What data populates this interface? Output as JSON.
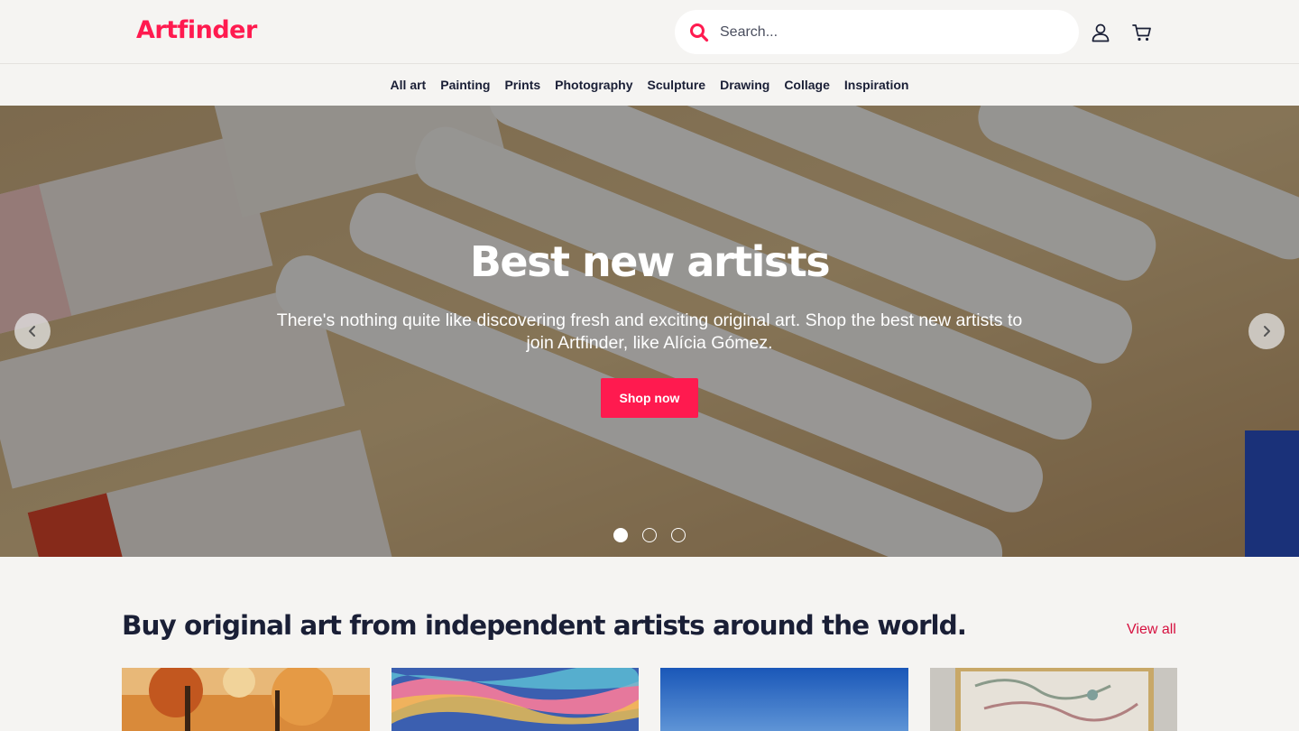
{
  "header": {
    "logo": "Artfinder",
    "search_placeholder": "Search...",
    "search_value": "",
    "icons": [
      "search-icon",
      "account-icon",
      "cart-icon"
    ],
    "brand_color": "#ff1a4f"
  },
  "nav": {
    "items": [
      {
        "label": "All art"
      },
      {
        "label": "Painting"
      },
      {
        "label": "Prints"
      },
      {
        "label": "Photography"
      },
      {
        "label": "Sculpture"
      },
      {
        "label": "Drawing"
      },
      {
        "label": "Collage"
      },
      {
        "label": "Inspiration"
      }
    ]
  },
  "hero": {
    "title": "Best new artists",
    "text": "There's nothing quite like discovering fresh and exciting original art. Shop the best new artists to join Artfinder, like Alícia Gómez.",
    "button": "Shop now",
    "slides": 3,
    "active_slide": 1,
    "icons": [
      "chevron-left-icon",
      "chevron-right-icon"
    ]
  },
  "section": {
    "title": "Buy original art from independent artists around the world.",
    "view_all": "View all",
    "view_all_color": "#d6103f"
  }
}
